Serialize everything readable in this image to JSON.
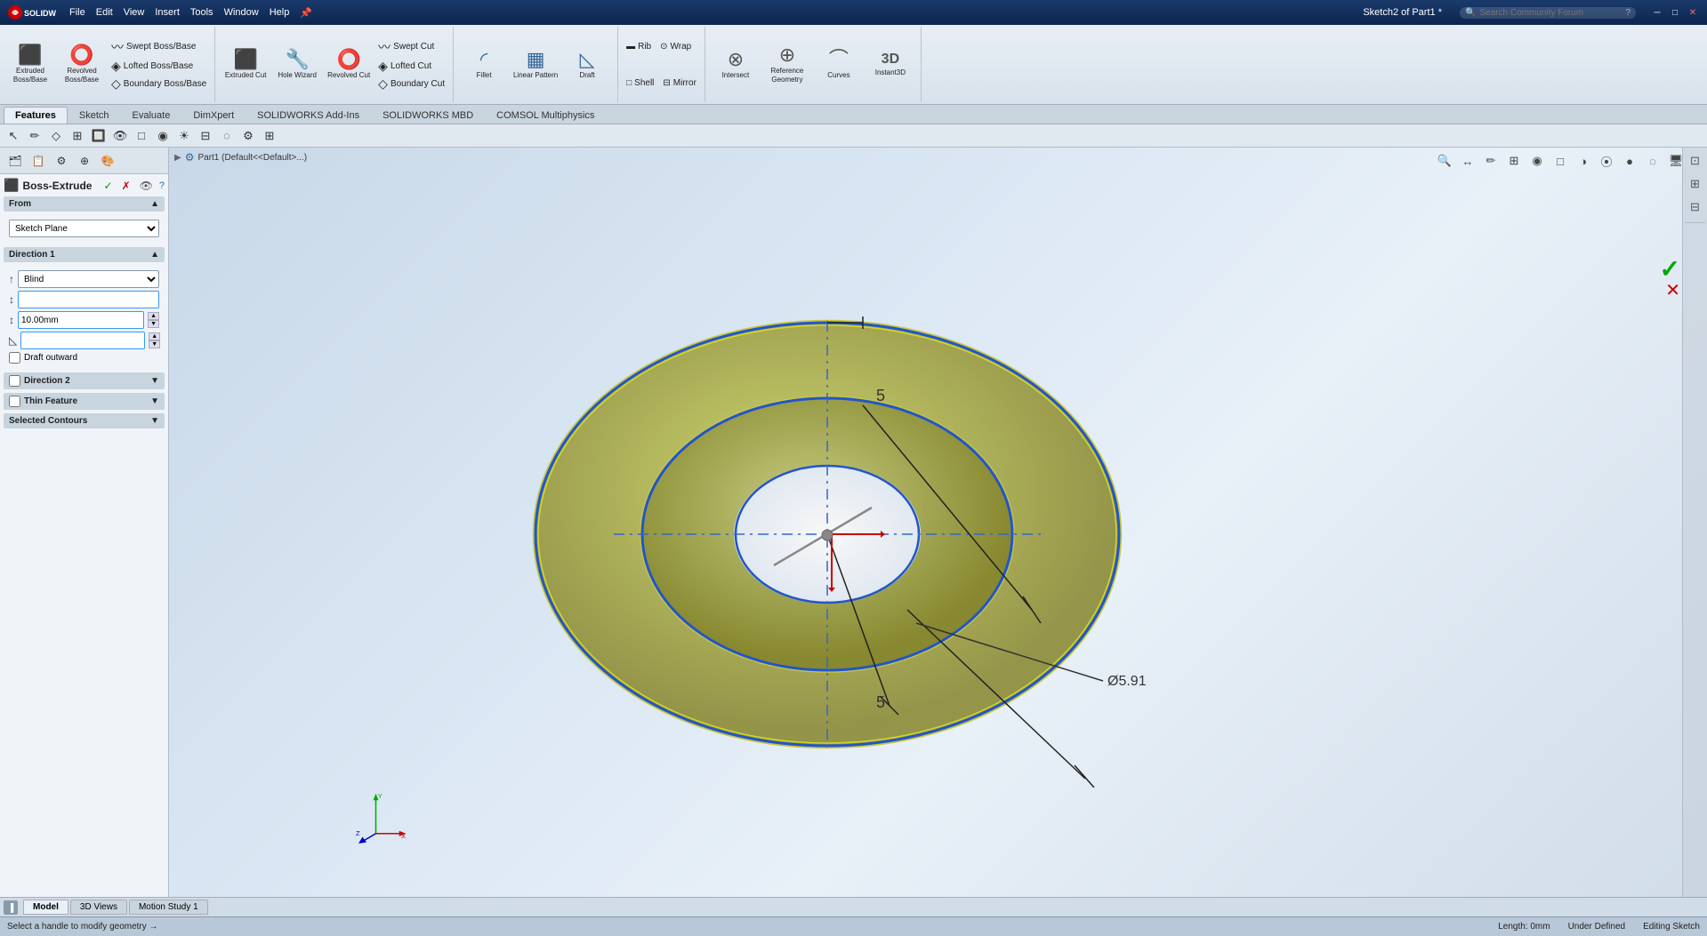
{
  "app": {
    "name": "SOLIDWORKS",
    "title": "Sketch2 of Part1 *",
    "logo_text": "SOLIDWORKS"
  },
  "menu": {
    "items": [
      "File",
      "Edit",
      "View",
      "Insert",
      "Tools",
      "Window",
      "Help"
    ]
  },
  "search": {
    "placeholder": "Search Community Forum"
  },
  "ribbon": {
    "groups": [
      {
        "name": "boss-base",
        "buttons": [
          {
            "id": "extruded-boss",
            "label": "Extruded Boss/Base",
            "icon": "⬛"
          },
          {
            "id": "revolved-boss",
            "label": "Revolved Boss/Base",
            "icon": "⭕"
          }
        ],
        "small_buttons": [
          {
            "id": "swept-boss",
            "label": "Swept Boss/Base",
            "icon": "〰"
          },
          {
            "id": "lofted-boss",
            "label": "Lofted Boss/Base",
            "icon": "◈"
          },
          {
            "id": "boundary-boss",
            "label": "Boundary Boss/Base",
            "icon": "◇"
          }
        ]
      },
      {
        "name": "cut",
        "buttons": [
          {
            "id": "extruded-cut",
            "label": "Extruded Cut",
            "icon": "⬛"
          },
          {
            "id": "hole-wizard",
            "label": "Hole Wizard",
            "icon": "🔧"
          },
          {
            "id": "revolved-cut",
            "label": "Revolved Cut",
            "icon": "⭕"
          }
        ],
        "small_buttons": [
          {
            "id": "swept-cut",
            "label": "Swept Cut",
            "icon": "〰"
          },
          {
            "id": "lofted-cut",
            "label": "Lofted Cut",
            "icon": "◈"
          },
          {
            "id": "boundary-cut",
            "label": "Boundary Cut",
            "icon": "◇"
          }
        ]
      },
      {
        "name": "features",
        "buttons": [
          {
            "id": "fillet",
            "label": "Fillet",
            "icon": "◜"
          },
          {
            "id": "linear-pattern",
            "label": "Linear Pattern",
            "icon": "▦"
          },
          {
            "id": "draft",
            "label": "Draft",
            "icon": "◺"
          }
        ]
      },
      {
        "name": "misc",
        "buttons": [
          {
            "id": "rib",
            "label": "Rib",
            "icon": "▬"
          },
          {
            "id": "wrap",
            "label": "Wrap",
            "icon": "⊙"
          },
          {
            "id": "shell",
            "label": "Shell",
            "icon": "□"
          },
          {
            "id": "mirror",
            "label": "Mirror",
            "icon": "⊟"
          }
        ]
      },
      {
        "name": "advanced",
        "buttons": [
          {
            "id": "intersect",
            "label": "Intersect",
            "icon": "⊗"
          },
          {
            "id": "reference-geometry",
            "label": "Reference Geometry",
            "icon": "⊕"
          },
          {
            "id": "curves",
            "label": "Curves",
            "icon": "⌒"
          },
          {
            "id": "instant3d",
            "label": "Instant3D",
            "icon": "3D"
          }
        ]
      }
    ]
  },
  "tabs": {
    "items": [
      "Features",
      "Sketch",
      "Evaluate",
      "DimXpert",
      "SOLIDWORKS Add-Ins",
      "SOLIDWORKS MBD",
      "COMSOL Multiphysics"
    ],
    "active": "Features"
  },
  "boss_extrude": {
    "title": "Boss-Extrude",
    "ok_label": "✓",
    "cancel_label": "✗",
    "preview_label": "👁",
    "from_section": "From",
    "from_value": "Sketch Plane",
    "direction1_section": "Direction 1",
    "direction1_type": "Blind",
    "direction1_depth": "10.00mm",
    "draft_outward_label": "Draft outward",
    "direction2_section": "Direction 2",
    "thin_feature_section": "Thin Feature",
    "selected_contours_section": "Selected Contours"
  },
  "viewport": {
    "breadcrumb": "Part1 (Default<<Default>...)",
    "annotation_5_top": "5",
    "annotation_5_bottom": "5",
    "annotation_diameter": "Ø5.91",
    "triad_label": "XYZ"
  },
  "statusbar": {
    "text": "Select a handle to modify geometry  →",
    "length": "Length: 0mm",
    "status": "Under Defined",
    "mode": "Editing Sketch"
  },
  "bottom_tabs": {
    "items": [
      "Model",
      "3D Views",
      "Motion Study 1"
    ],
    "active": "Model"
  },
  "colors": {
    "accent_blue": "#0066cc",
    "highlight_yellow": "#c8c840",
    "selection_blue": "#2255cc",
    "bg_gradient_start": "#c8d8e8",
    "bg_gradient_end": "#e8f0f8"
  }
}
